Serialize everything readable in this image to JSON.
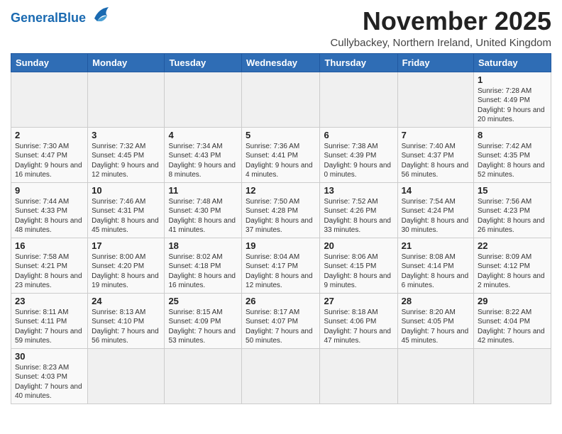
{
  "logo": {
    "general": "General",
    "blue": "Blue"
  },
  "title": "November 2025",
  "location": "Cullybackey, Northern Ireland, United Kingdom",
  "days_header": [
    "Sunday",
    "Monday",
    "Tuesday",
    "Wednesday",
    "Thursday",
    "Friday",
    "Saturday"
  ],
  "weeks": [
    [
      {
        "day": "",
        "info": ""
      },
      {
        "day": "",
        "info": ""
      },
      {
        "day": "",
        "info": ""
      },
      {
        "day": "",
        "info": ""
      },
      {
        "day": "",
        "info": ""
      },
      {
        "day": "",
        "info": ""
      },
      {
        "day": "1",
        "info": "Sunrise: 7:28 AM\nSunset: 4:49 PM\nDaylight: 9 hours and 20 minutes."
      }
    ],
    [
      {
        "day": "2",
        "info": "Sunrise: 7:30 AM\nSunset: 4:47 PM\nDaylight: 9 hours and 16 minutes."
      },
      {
        "day": "3",
        "info": "Sunrise: 7:32 AM\nSunset: 4:45 PM\nDaylight: 9 hours and 12 minutes."
      },
      {
        "day": "4",
        "info": "Sunrise: 7:34 AM\nSunset: 4:43 PM\nDaylight: 9 hours and 8 minutes."
      },
      {
        "day": "5",
        "info": "Sunrise: 7:36 AM\nSunset: 4:41 PM\nDaylight: 9 hours and 4 minutes."
      },
      {
        "day": "6",
        "info": "Sunrise: 7:38 AM\nSunset: 4:39 PM\nDaylight: 9 hours and 0 minutes."
      },
      {
        "day": "7",
        "info": "Sunrise: 7:40 AM\nSunset: 4:37 PM\nDaylight: 8 hours and 56 minutes."
      },
      {
        "day": "8",
        "info": "Sunrise: 7:42 AM\nSunset: 4:35 PM\nDaylight: 8 hours and 52 minutes."
      }
    ],
    [
      {
        "day": "9",
        "info": "Sunrise: 7:44 AM\nSunset: 4:33 PM\nDaylight: 8 hours and 48 minutes."
      },
      {
        "day": "10",
        "info": "Sunrise: 7:46 AM\nSunset: 4:31 PM\nDaylight: 8 hours and 45 minutes."
      },
      {
        "day": "11",
        "info": "Sunrise: 7:48 AM\nSunset: 4:30 PM\nDaylight: 8 hours and 41 minutes."
      },
      {
        "day": "12",
        "info": "Sunrise: 7:50 AM\nSunset: 4:28 PM\nDaylight: 8 hours and 37 minutes."
      },
      {
        "day": "13",
        "info": "Sunrise: 7:52 AM\nSunset: 4:26 PM\nDaylight: 8 hours and 33 minutes."
      },
      {
        "day": "14",
        "info": "Sunrise: 7:54 AM\nSunset: 4:24 PM\nDaylight: 8 hours and 30 minutes."
      },
      {
        "day": "15",
        "info": "Sunrise: 7:56 AM\nSunset: 4:23 PM\nDaylight: 8 hours and 26 minutes."
      }
    ],
    [
      {
        "day": "16",
        "info": "Sunrise: 7:58 AM\nSunset: 4:21 PM\nDaylight: 8 hours and 23 minutes."
      },
      {
        "day": "17",
        "info": "Sunrise: 8:00 AM\nSunset: 4:20 PM\nDaylight: 8 hours and 19 minutes."
      },
      {
        "day": "18",
        "info": "Sunrise: 8:02 AM\nSunset: 4:18 PM\nDaylight: 8 hours and 16 minutes."
      },
      {
        "day": "19",
        "info": "Sunrise: 8:04 AM\nSunset: 4:17 PM\nDaylight: 8 hours and 12 minutes."
      },
      {
        "day": "20",
        "info": "Sunrise: 8:06 AM\nSunset: 4:15 PM\nDaylight: 8 hours and 9 minutes."
      },
      {
        "day": "21",
        "info": "Sunrise: 8:08 AM\nSunset: 4:14 PM\nDaylight: 8 hours and 6 minutes."
      },
      {
        "day": "22",
        "info": "Sunrise: 8:09 AM\nSunset: 4:12 PM\nDaylight: 8 hours and 2 minutes."
      }
    ],
    [
      {
        "day": "23",
        "info": "Sunrise: 8:11 AM\nSunset: 4:11 PM\nDaylight: 7 hours and 59 minutes."
      },
      {
        "day": "24",
        "info": "Sunrise: 8:13 AM\nSunset: 4:10 PM\nDaylight: 7 hours and 56 minutes."
      },
      {
        "day": "25",
        "info": "Sunrise: 8:15 AM\nSunset: 4:09 PM\nDaylight: 7 hours and 53 minutes."
      },
      {
        "day": "26",
        "info": "Sunrise: 8:17 AM\nSunset: 4:07 PM\nDaylight: 7 hours and 50 minutes."
      },
      {
        "day": "27",
        "info": "Sunrise: 8:18 AM\nSunset: 4:06 PM\nDaylight: 7 hours and 47 minutes."
      },
      {
        "day": "28",
        "info": "Sunrise: 8:20 AM\nSunset: 4:05 PM\nDaylight: 7 hours and 45 minutes."
      },
      {
        "day": "29",
        "info": "Sunrise: 8:22 AM\nSunset: 4:04 PM\nDaylight: 7 hours and 42 minutes."
      }
    ],
    [
      {
        "day": "30",
        "info": "Sunrise: 8:23 AM\nSunset: 4:03 PM\nDaylight: 7 hours and 40 minutes."
      },
      {
        "day": "",
        "info": ""
      },
      {
        "day": "",
        "info": ""
      },
      {
        "day": "",
        "info": ""
      },
      {
        "day": "",
        "info": ""
      },
      {
        "day": "",
        "info": ""
      },
      {
        "day": "",
        "info": ""
      }
    ]
  ]
}
